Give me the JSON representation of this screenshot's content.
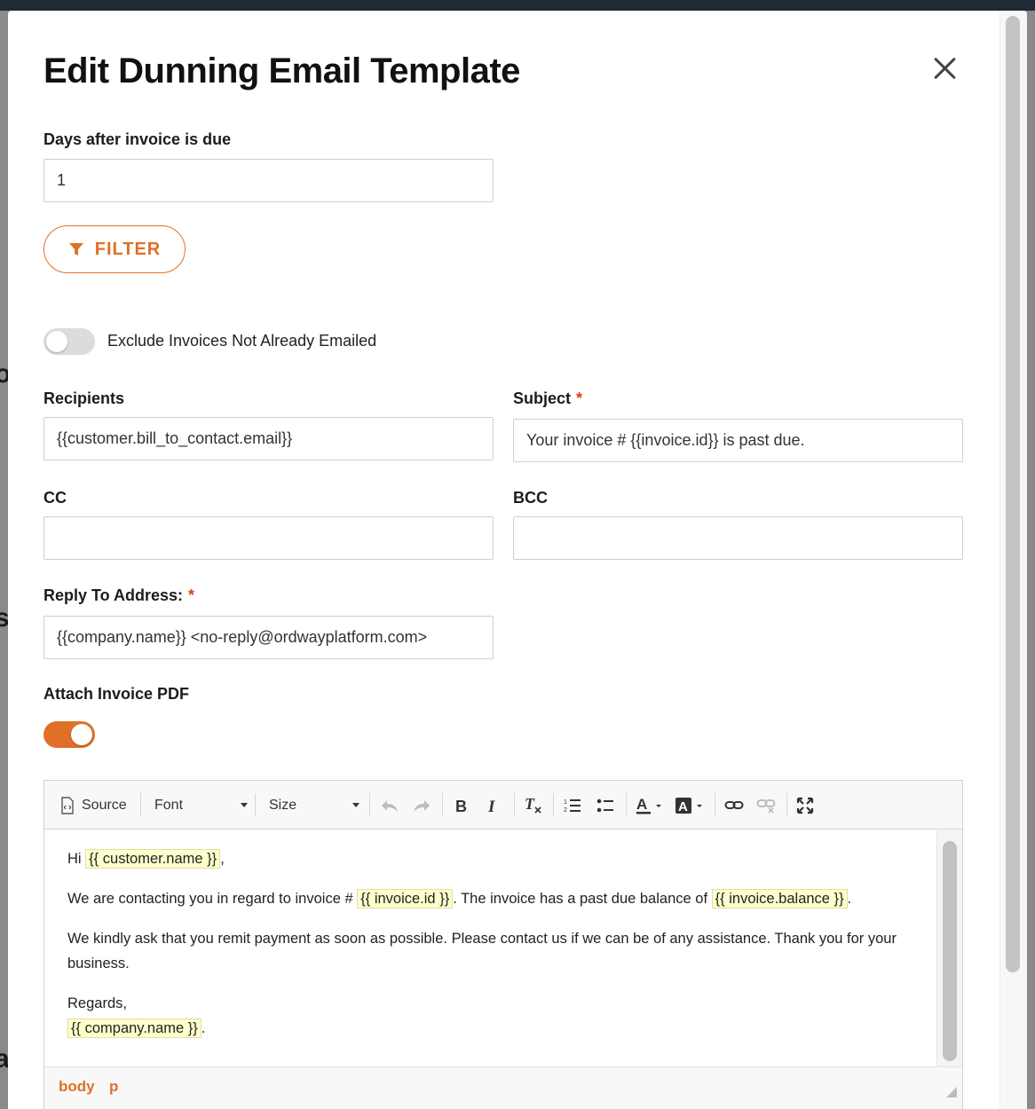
{
  "modal": {
    "title": "Edit Dunning Email Template"
  },
  "days_after": {
    "label": "Days after invoice is due",
    "value": "1"
  },
  "filter_button": {
    "label": "FILTER"
  },
  "exclude_toggle": {
    "label": "Exclude Invoices Not Already Emailed",
    "state": "off"
  },
  "recipients": {
    "label": "Recipients",
    "value": "{{customer.bill_to_contact.email}}"
  },
  "subject": {
    "label": "Subject",
    "required_mark": "*",
    "value": "Your invoice # {{invoice.id}} is past due."
  },
  "cc": {
    "label": "CC",
    "value": ""
  },
  "bcc": {
    "label": "BCC",
    "value": ""
  },
  "reply_to": {
    "label": "Reply To Address:",
    "required_mark": "*",
    "value": "{{company.name}} <no-reply@ordwayplatform.com>"
  },
  "attach_pdf": {
    "label": "Attach Invoice PDF",
    "state": "on"
  },
  "editor": {
    "toolbar": {
      "source_label": "Source",
      "font_label": "Font",
      "size_label": "Size"
    },
    "body": {
      "greeting_prefix": "Hi ",
      "greeting_tag": "{{ customer.name }}",
      "greeting_suffix": ",",
      "line2_prefix": "We are contacting you in regard to invoice # ",
      "line2_tag1": "{{ invoice.id }}",
      "line2_mid": ". The invoice has a past due balance of ",
      "line2_tag2": "{{ invoice.balance }}",
      "line2_suffix": ".",
      "line3": "We kindly ask that you remit payment as soon as possible. Please contact us if we can be of any assistance. Thank you for your business.",
      "regards": "Regards,",
      "signature_tag": "{{ company.name }}",
      "signature_suffix": "."
    },
    "status_path": [
      "body",
      "p"
    ]
  },
  "colors": {
    "accent": "#e07027",
    "required": "#d84315",
    "tag_highlight": "#ffffcc"
  }
}
